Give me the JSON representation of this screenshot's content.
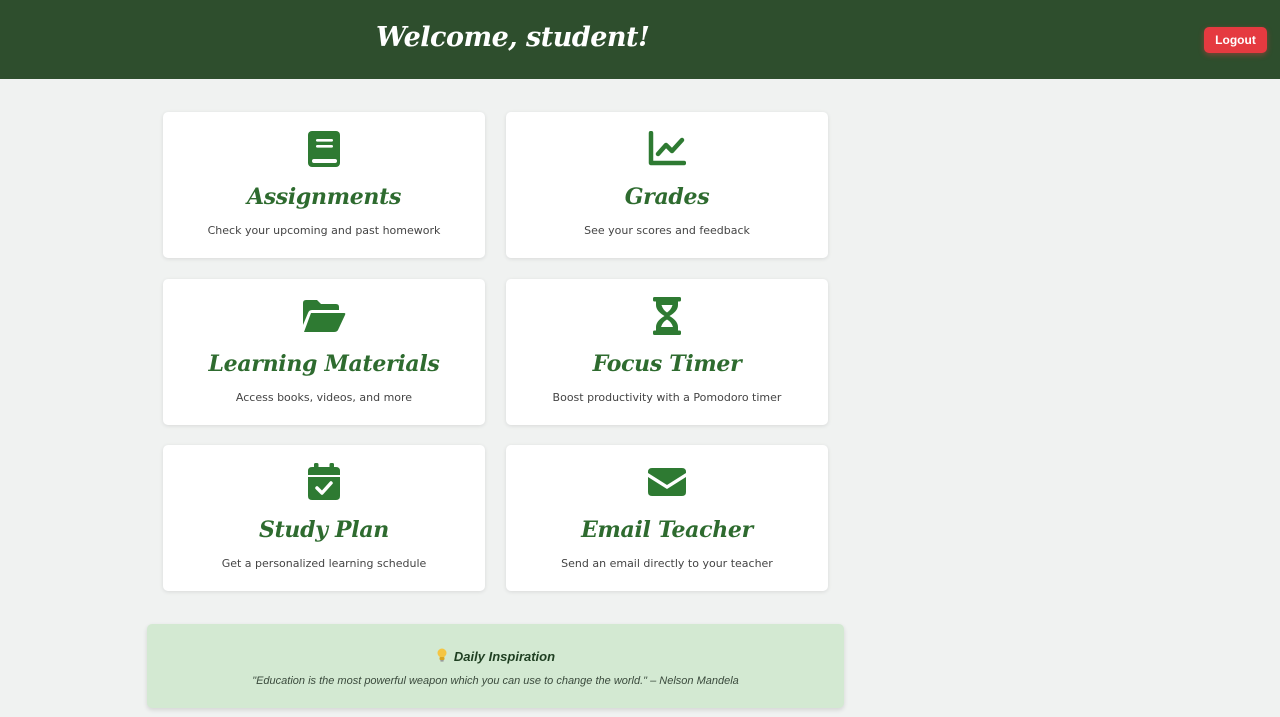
{
  "header": {
    "title": "Welcome, student!",
    "logout_label": "Logout"
  },
  "cards": [
    {
      "icon": "book-icon",
      "title": "Assignments",
      "description": "Check your upcoming and past homework"
    },
    {
      "icon": "chart-line-icon",
      "title": "Grades",
      "description": "See your scores and feedback"
    },
    {
      "icon": "folder-open-icon",
      "title": "Learning Materials",
      "description": "Access books, videos, and more"
    },
    {
      "icon": "hourglass-icon",
      "title": "Focus Timer",
      "description": "Boost productivity with a Pomodoro timer"
    },
    {
      "icon": "calendar-check-icon",
      "title": "Study Plan",
      "description": "Get a personalized learning schedule"
    },
    {
      "icon": "envelope-icon",
      "title": "Email Teacher",
      "description": "Send an email directly to your teacher"
    }
  ],
  "inspiration": {
    "icon": "lightbulb-icon",
    "heading": "Daily Inspiration",
    "quote": "\"Education is the most powerful weapon which you can use to change the world.\" – Nelson Mandela"
  },
  "colors": {
    "header_bg": "#2e4e2d",
    "accent_green": "#2e7a32",
    "logout_red": "#e53a40",
    "inspiration_bg": "#d3e9d2"
  }
}
